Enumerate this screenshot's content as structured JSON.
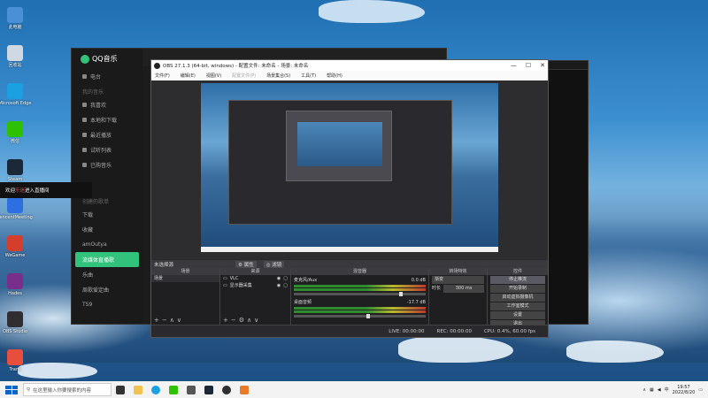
{
  "desktop_icons": [
    {
      "label": "此电脑",
      "color": "#4a90d9"
    },
    {
      "label": "回收站",
      "color": "#cfd8e3"
    },
    {
      "label": "Microsoft Edge",
      "color": "#1ba1e2"
    },
    {
      "label": "微信",
      "color": "#2dc100"
    },
    {
      "label": "Steam",
      "color": "#1b2838"
    },
    {
      "label": "TencentMeeting",
      "color": "#2d6fe0"
    },
    {
      "label": "WeGame",
      "color": "#d43e2b"
    },
    {
      "label": "Hades",
      "color": "#7a2e8c"
    },
    {
      "label": "OBS Studio",
      "color": "#302e31"
    },
    {
      "label": "Trans",
      "color": "#e84e3c"
    }
  ],
  "qq": {
    "app_name": "QQ音乐",
    "nav_items": [
      "电台",
      "我的音乐",
      "我喜欢",
      "本地和下载",
      "最近播放",
      "试听列表",
      "已购音乐"
    ],
    "section_label": "创建的歌单",
    "playlists": [
      "下载",
      "收藏",
      "amOutya",
      "流媒体直播歌",
      "乐曲",
      "周歌爱定曲",
      "TS9"
    ],
    "active_playlist": "流媒体直播歌"
  },
  "banner": {
    "prefix": "欢迎",
    "highlight": "乐迷",
    "suffix": "进入直播间"
  },
  "obs": {
    "title": "OBS 27.1.3 (64-bit, windows) - 配置文件: 未命名 - 场景: 未命名",
    "menu": [
      "文件(F)",
      "编辑(E)",
      "视图(V)",
      "配置文件(P)",
      "场景集合(S)",
      "工具(T)",
      "帮助(H)"
    ],
    "no_source": "未选择源",
    "props_btn": "属性",
    "filters_btn": "滤镜",
    "scenes_header": "场景",
    "sources_header": "来源",
    "mixer_header": "混音器",
    "transitions_header": "转场特效",
    "controls_header": "控件",
    "scene_item": "场景",
    "sources": [
      "VLC",
      "显示器采集"
    ],
    "mixer": [
      {
        "name": "麦克风/Aux",
        "db": "0.0 dB",
        "level": 0.8
      },
      {
        "name": "桌面音频",
        "db": "-17.7 dB",
        "level": 0.55
      }
    ],
    "transition_value": "渐变",
    "duration_label": "时长",
    "duration_value": "300 ms",
    "controls": [
      "停止推流",
      "开始录制",
      "启动虚拟摄像机",
      "工作室模式",
      "设置",
      "退出"
    ],
    "status": {
      "live": "LIVE: 00:00:00",
      "rec": "REC: 00:00:00",
      "cpu": "CPU: 0.4%, 60.00 fps"
    }
  },
  "taskbar": {
    "search_placeholder": "在这里输入你要搜索的内容",
    "time": "19:57",
    "date": "2022/8/20"
  }
}
